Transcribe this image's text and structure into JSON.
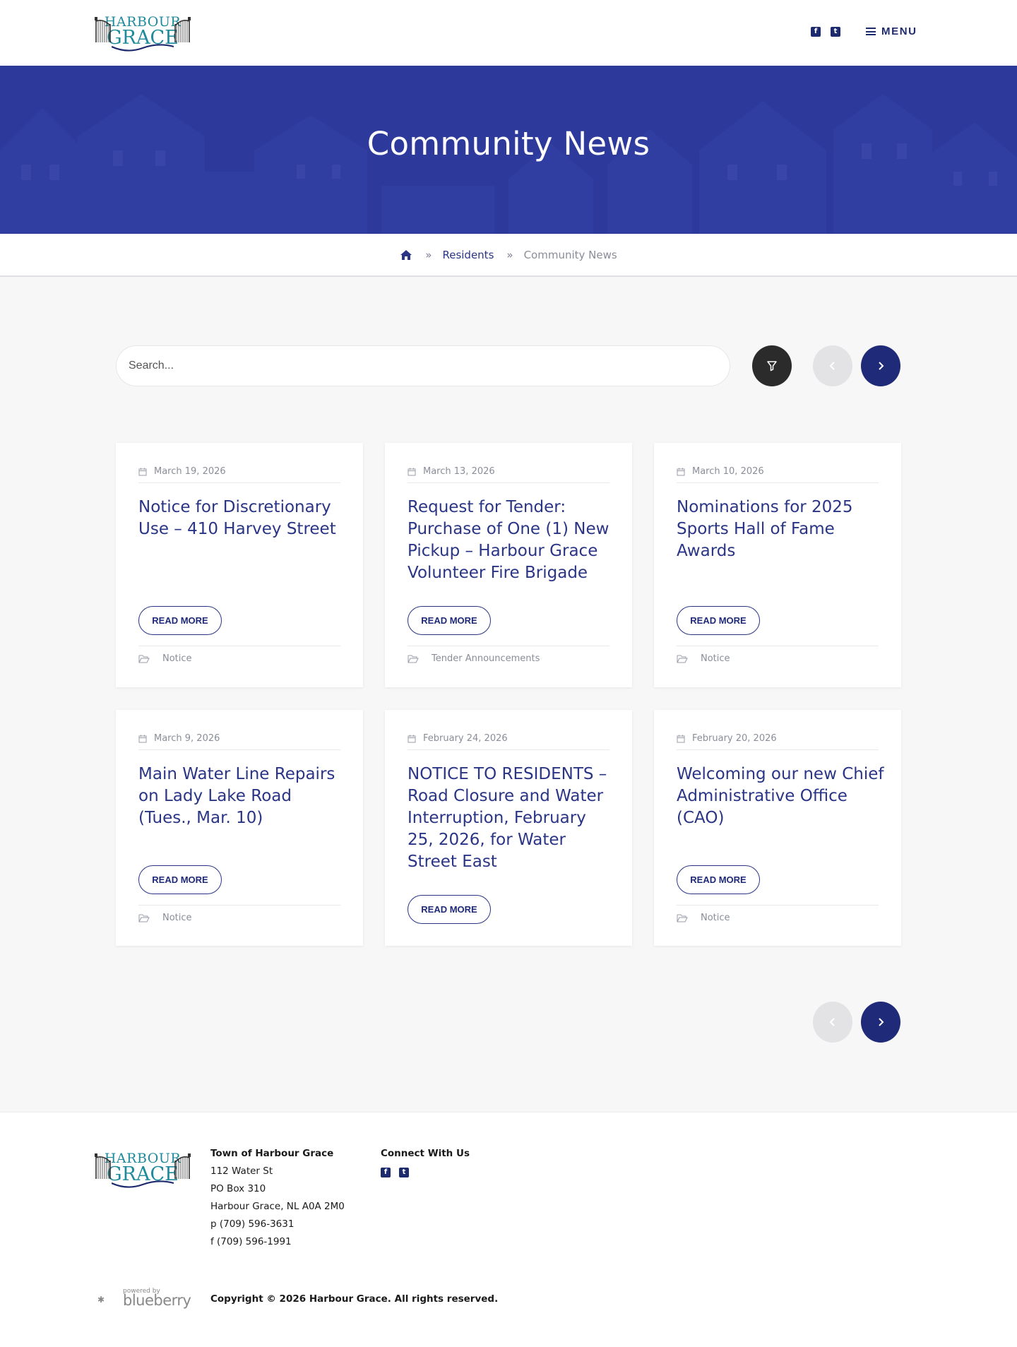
{
  "header": {
    "logo_line1": "HARBOUR",
    "logo_line2": "GRACE",
    "social": [
      "f",
      "t"
    ],
    "menu_label": "MENU"
  },
  "hero": {
    "title": "Community News"
  },
  "breadcrumb": {
    "items": [
      "Residents",
      "Community News"
    ],
    "separator": "»"
  },
  "search": {
    "placeholder": "Search..."
  },
  "cards": [
    {
      "date": "March 19, 2026",
      "title": "Notice for Discretionary Use – 410 Harvey Street",
      "button": "READ MORE",
      "category": "Notice"
    },
    {
      "date": "March 13, 2026",
      "title": "Request for Tender: Purchase of One (1) New Pickup – Harbour Grace Volunteer Fire Brigade",
      "button": "READ MORE",
      "category": "Tender Announcements"
    },
    {
      "date": "March 10, 2026",
      "title": "Nominations for 2025 Sports Hall of Fame Awards",
      "button": "READ MORE",
      "category": "Notice"
    },
    {
      "date": "March 9, 2026",
      "title": "Main Water Line Repairs on Lady Lake Road (Tues., Mar. 10)",
      "button": "READ MORE",
      "category": "Notice"
    },
    {
      "date": "February 24, 2026",
      "title": "NOTICE TO RESIDENTS – Road Closure and Water Interruption, February 25, 2026, for Water Street East",
      "button": "READ MORE",
      "category": ""
    },
    {
      "date": "February 20, 2026",
      "title": "Welcoming our new Chief Administrative Office (CAO)",
      "button": "READ MORE",
      "category": "Notice"
    }
  ],
  "footer": {
    "logo_line1": "HARBOUR",
    "logo_line2": "GRACE",
    "address": {
      "heading": "Town of Harbour Grace",
      "lines": [
        "112 Water St",
        "PO Box 310",
        "Harbour Grace, NL A0A 2M0",
        "p (709) 596-3631",
        "f (709) 596-1991"
      ]
    },
    "connect": {
      "heading": "Connect With Us",
      "social": [
        "f",
        "t"
      ]
    },
    "powered_by": "powered by",
    "powered_brand": "blueberry",
    "copyright": "Copyright © 2026 Harbour Grace. All rights reserved."
  },
  "colors": {
    "primary": "#2a3585",
    "hero_bg": "#2d3a9b",
    "button_dark": "#1f2a78",
    "filter_btn": "#2b2b2b",
    "teal_logo": "#1e8a9b"
  }
}
